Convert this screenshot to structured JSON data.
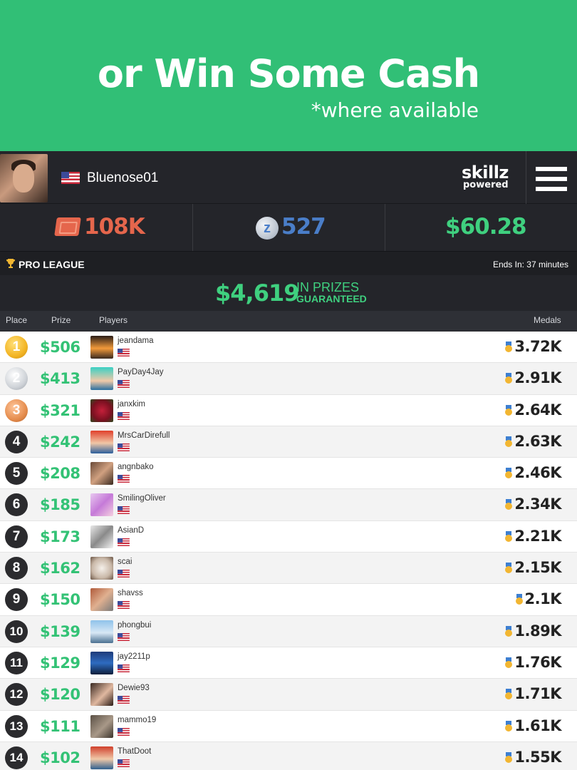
{
  "banner": {
    "title": "or Win Some Cash",
    "subtitle": "*where available"
  },
  "header": {
    "username": "Bluenose01",
    "brand": "skillz",
    "brand_sub": "powered",
    "menu_icon": "hamburger-menu-icon"
  },
  "stats": {
    "tickets": "108K",
    "tickets_color": "#e5664c",
    "z_coins": "527",
    "z_coins_color": "#4a7ec9",
    "cash": "$60.28",
    "cash_color": "#3fd07f"
  },
  "league": {
    "title": "PRO LEAGUE",
    "ends": "Ends In: 37 minutes",
    "prize_amount": "$4,619",
    "prize_in": "IN PRIZES",
    "prize_guaranteed": "GUARANTEED"
  },
  "columns": {
    "place": "Place",
    "prize": "Prize",
    "players": "Players",
    "medals": "Medals"
  },
  "leaderboard": [
    {
      "place": "1",
      "prize": "$506",
      "player": "jeandama",
      "medals": "3.72K"
    },
    {
      "place": "2",
      "prize": "$413",
      "player": "PayDay4Jay",
      "medals": "2.91K"
    },
    {
      "place": "3",
      "prize": "$321",
      "player": "janxkim",
      "medals": "2.64K"
    },
    {
      "place": "4",
      "prize": "$242",
      "player": "MrsCarDirefull",
      "medals": "2.63K"
    },
    {
      "place": "5",
      "prize": "$208",
      "player": "angnbako",
      "medals": "2.46K"
    },
    {
      "place": "6",
      "prize": "$185",
      "player": "SmilingOliver",
      "medals": "2.34K"
    },
    {
      "place": "7",
      "prize": "$173",
      "player": "AsianD",
      "medals": "2.21K"
    },
    {
      "place": "8",
      "prize": "$162",
      "player": "scai",
      "medals": "2.15K"
    },
    {
      "place": "9",
      "prize": "$150",
      "player": "shavss",
      "medals": "2.1K"
    },
    {
      "place": "10",
      "prize": "$139",
      "player": "phongbui",
      "medals": "1.89K"
    },
    {
      "place": "11",
      "prize": "$129",
      "player": "jay2211p",
      "medals": "1.76K"
    },
    {
      "place": "12",
      "prize": "$120",
      "player": "Dewie93",
      "medals": "1.71K"
    },
    {
      "place": "13",
      "prize": "$111",
      "player": "mammo19",
      "medals": "1.61K"
    },
    {
      "place": "14",
      "prize": "$102",
      "player": "ThatDoot",
      "medals": "1.55K"
    }
  ]
}
